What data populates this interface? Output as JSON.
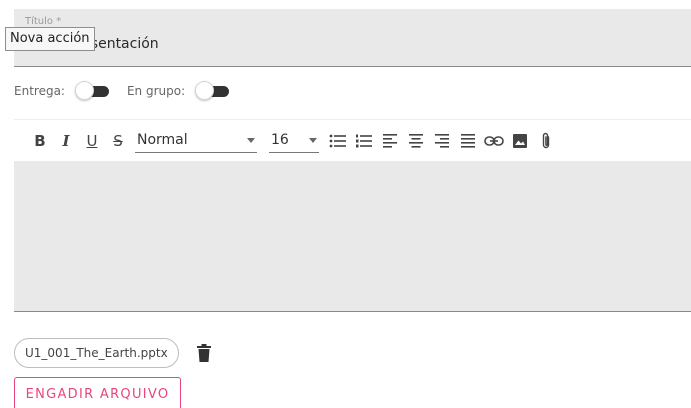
{
  "title_field": {
    "label": "Título *",
    "value": "Terra. Presentación"
  },
  "tooltip": {
    "text": "Nova acción"
  },
  "toggles": {
    "entrega_label": "Entrega:",
    "grupo_label": "En grupo:"
  },
  "toolbar": {
    "style_value": "Normal",
    "size_value": "16",
    "icons": [
      "bold-icon",
      "italic-icon",
      "underline-icon",
      "strikethrough-icon",
      "bullet-list-icon",
      "numbered-list-icon",
      "align-left-icon",
      "align-center-icon",
      "align-right-icon",
      "align-justify-icon",
      "link-icon",
      "image-icon",
      "attach-icon"
    ]
  },
  "editor": {
    "content": ""
  },
  "attachment": {
    "filename": "U1_001_The_Earth.pptx"
  },
  "add_file_button": {
    "label": "ENGADIR ARQUIVO"
  },
  "colors": {
    "accent": "#e8467c",
    "field_bg": "#e9e9e9",
    "toggle_track": "#333333"
  }
}
